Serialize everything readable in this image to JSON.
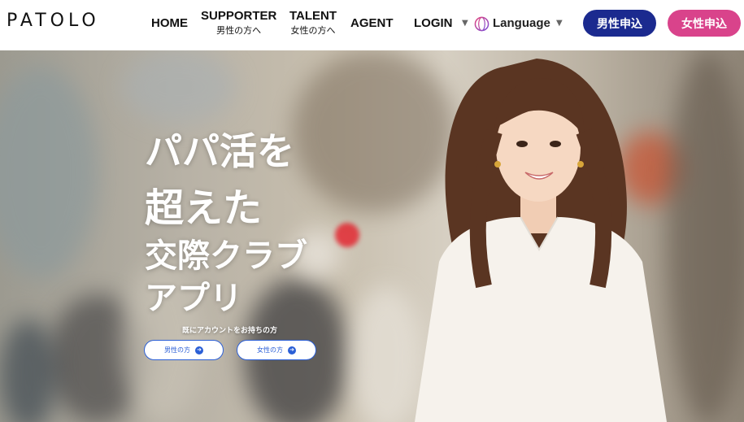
{
  "header": {
    "logo": "PATOLO",
    "nav": {
      "home": "HOME",
      "supporter": "SUPPORTER",
      "supporter_sub": "男性の方へ",
      "talent": "TALENT",
      "talent_sub": "女性の方へ",
      "agent": "AGENT",
      "login": "LOGIN",
      "language": "Language"
    },
    "buttons": {
      "male_apply": "男性申込",
      "female_apply": "女性申込"
    }
  },
  "hero": {
    "title_line1": "パパ活を",
    "title_line2": "超えた",
    "title_line3": "交際クラブ",
    "title_line4": "アプリ",
    "member_label": "既にアカウントをお持ちの方",
    "login_male": "男性の方",
    "login_female": "女性の方"
  },
  "colors": {
    "male_button": "#1b2a8f",
    "female_button": "#d9438b",
    "login_accent": "#2b5fd6"
  },
  "icons": {
    "globe": "globe-icon",
    "chevron": "chevron-down-icon",
    "arrow": "arrow-right-icon"
  }
}
